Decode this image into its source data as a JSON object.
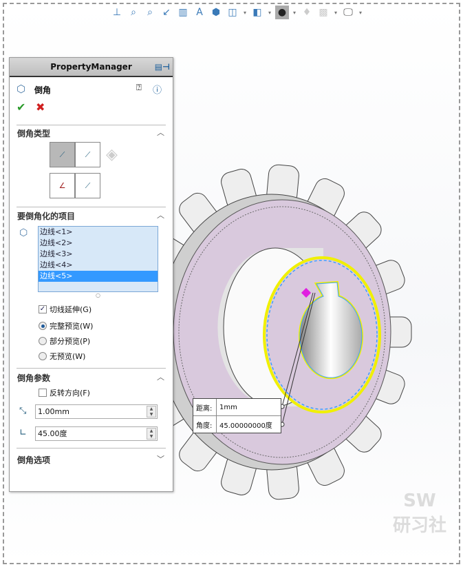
{
  "toolbar": {
    "icons": [
      "view-orientation",
      "zoom-to-fit",
      "zoom-to-area",
      "previous-view",
      "section-view",
      "dynamic-annotation",
      "view-orientation-cube",
      "display-style",
      "hide-show-items",
      "edit-appearance",
      "apply-scene",
      "view-settings",
      "display"
    ]
  },
  "property_manager": {
    "title": "PropertyManager",
    "feature_name": "倒角",
    "sections": {
      "chamfer_type": {
        "title": "倒角类型"
      },
      "items": {
        "title": "要倒角化的项目",
        "edges": [
          "边线<1>",
          "边线<2>",
          "边线<3>",
          "边线<4>",
          "边线<5>"
        ],
        "selected_index": 4,
        "tangent_propagation": "切线延伸(G)",
        "tangent_checked": true,
        "preview_options": [
          "完整预览(W)",
          "部分预览(P)",
          "无预览(W)"
        ],
        "preview_selected": 0
      },
      "params": {
        "title": "倒角参数",
        "reverse_direction": "反转方向(F)",
        "reverse_checked": false,
        "distance": "1.00mm",
        "angle": "45.00度"
      },
      "options": {
        "title": "倒角选项"
      }
    }
  },
  "callout": {
    "distance_label": "距离:",
    "distance_value": "1mm",
    "angle_label": "角度:",
    "angle_value": "45.00000000度"
  },
  "watermark": {
    "line1": "SW",
    "line2": "研习社"
  },
  "colors": {
    "face": "#d9c9dd",
    "highlight": "#f0f000",
    "selection": "#3aa0ff",
    "accent": "#3399ff"
  }
}
